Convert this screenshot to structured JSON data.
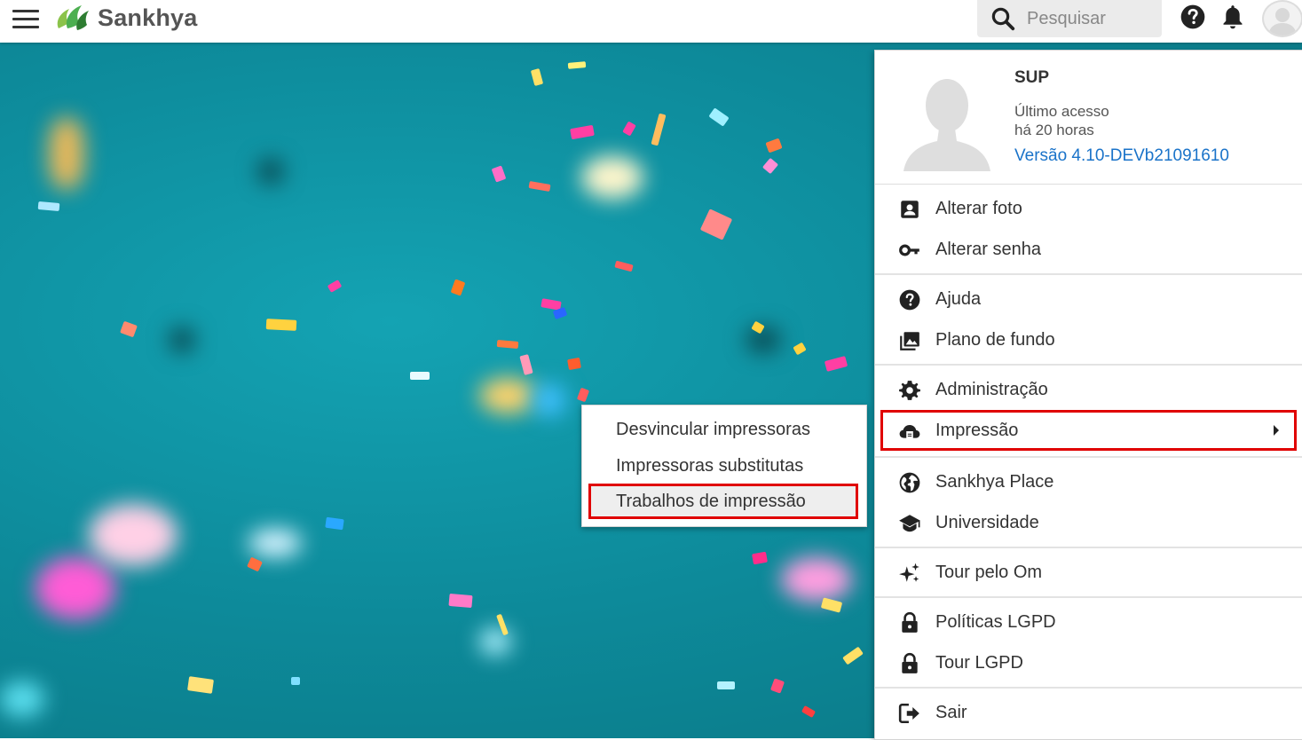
{
  "header": {
    "brand": "Sankhya",
    "search_placeholder": "Pesquisar"
  },
  "colors": {
    "brand_green": "#4caf50",
    "link_blue": "#1a73c9",
    "highlight_red": "#e00000",
    "background_teal": "#0d8a9a"
  },
  "profile": {
    "name": "SUP",
    "last_access_line1": "Último acesso",
    "last_access_line2": "há 20 horas",
    "version": "Versão 4.10-DEVb21091610"
  },
  "menu": {
    "change_photo": "Alterar foto",
    "change_password": "Alterar senha",
    "help": "Ajuda",
    "background": "Plano de fundo",
    "administration": "Administração",
    "printing": "Impressão",
    "sankhya_place": "Sankhya Place",
    "university": "Universidade",
    "tour_om": "Tour pelo Om",
    "lgpd_policies": "Políticas LGPD",
    "lgpd_tour": "Tour LGPD",
    "logout": "Sair"
  },
  "submenu": {
    "unlink_printers": "Desvincular impressoras",
    "substitute_printers": "Impressoras substitutas",
    "print_jobs": "Trabalhos de impressão"
  }
}
